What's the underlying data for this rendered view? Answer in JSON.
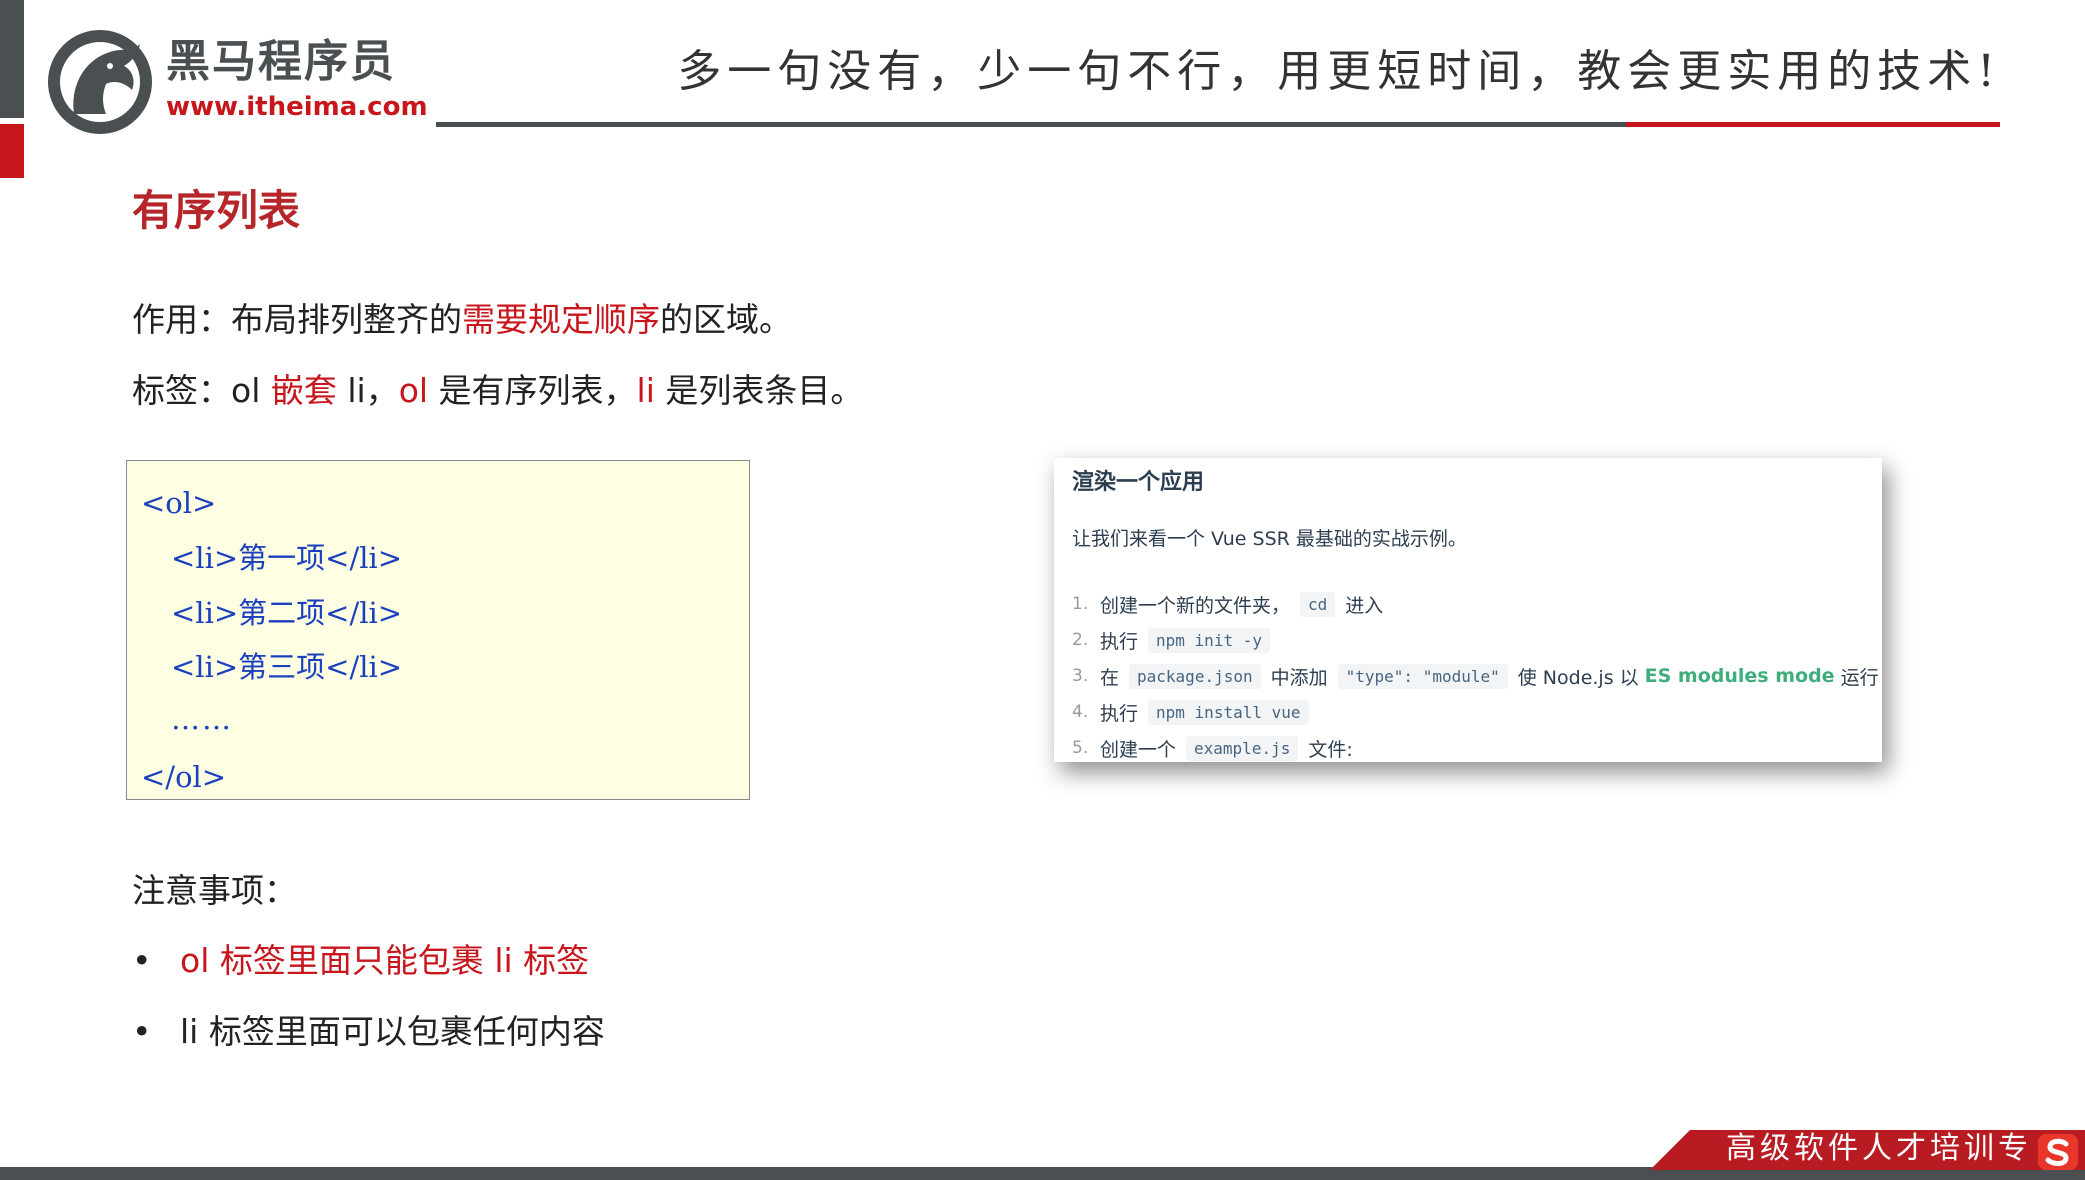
{
  "header": {
    "brand_name": "黑马程序员",
    "brand_url": "www.itheima.com",
    "slogan": "多一句没有，少一句不行，用更短时间，教会更实用的技术!"
  },
  "slide": {
    "title": "有序列表",
    "line1": {
      "prefix": "作用：布局排列整齐的",
      "highlight": "需要规定顺序",
      "suffix": "的区域。"
    },
    "line2": {
      "s1": "标签：ol ",
      "h1": "嵌套",
      "s2": " li，",
      "h2": "ol",
      "s3": " 是有序列表，",
      "h3": "li",
      "s4": " 是列表条目。"
    },
    "code_lines": [
      "<ol>",
      "<li>第一项</li>",
      "<li>第二项</li>",
      "<li>第三项</li>",
      "……",
      "</ol>"
    ],
    "notes_label": "注意事项：",
    "bullets": [
      "ol 标签里面只能包裹 li 标签",
      "li 标签里面可以包裹任何内容"
    ],
    "bullet_glyph": "•"
  },
  "screenshot": {
    "title": "渲染一个应用",
    "description": "让我们来看一个 Vue SSR 最基础的实战示例。",
    "steps": [
      {
        "num": "1.",
        "a": "创建一个新的文件夹，",
        "code1": "cd",
        "b": "进入"
      },
      {
        "num": "2.",
        "a": "执行",
        "code1": "npm init -y"
      },
      {
        "num": "3.",
        "a": "在",
        "code1": "package.json",
        "b": "中添加",
        "code2": "\"type\": \"module\"",
        "c": "使 Node.js 以",
        "link": "ES modules mode",
        "d": "运行"
      },
      {
        "num": "4.",
        "a": "执行",
        "code1": "npm install vue"
      },
      {
        "num": "5.",
        "a": "创建一个",
        "code1": "example.js",
        "b": "文件:"
      }
    ]
  },
  "footer": {
    "text": "高级软件人才培训专"
  },
  "colors": {
    "accent_red": "#c8161d",
    "dark_gray": "#4a4f52",
    "code_blue": "#1a3fbf",
    "link_green": "#3eaf7c",
    "codebox_bg": "#fefee2"
  }
}
